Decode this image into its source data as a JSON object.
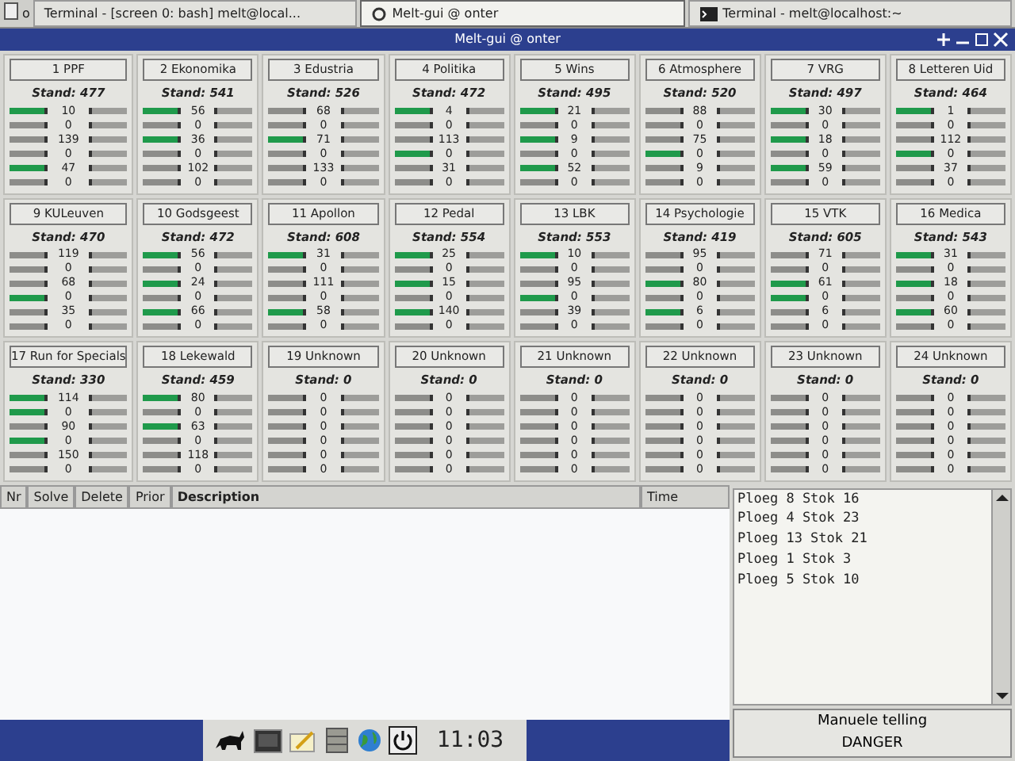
{
  "taskbar_top": {
    "label": "o",
    "tasks": [
      {
        "label": "Terminal - [screen 0: bash] melt@local...",
        "kind": "plain",
        "selected": false
      },
      {
        "label": "Melt-gui @ onter",
        "kind": "app",
        "selected": true
      },
      {
        "label": "Terminal - melt@localhost:~",
        "kind": "terminal",
        "selected": false
      }
    ]
  },
  "window": {
    "title": "Melt-gui @ onter"
  },
  "teams": [
    {
      "label": "1 PPF",
      "stand": "Stand: 477",
      "rows": [
        {
          "value": "10",
          "active": true
        },
        {
          "value": "0",
          "active": false
        },
        {
          "value": "139",
          "active": false
        },
        {
          "value": "0",
          "active": false
        },
        {
          "value": "47",
          "active": true
        },
        {
          "value": "0",
          "active": false
        }
      ]
    },
    {
      "label": "2 Ekonomika",
      "stand": "Stand: 541",
      "rows": [
        {
          "value": "56",
          "active": true
        },
        {
          "value": "0",
          "active": false
        },
        {
          "value": "36",
          "active": true
        },
        {
          "value": "0",
          "active": false
        },
        {
          "value": "102",
          "active": false
        },
        {
          "value": "0",
          "active": false
        }
      ]
    },
    {
      "label": "3 Edustria",
      "stand": "Stand: 526",
      "rows": [
        {
          "value": "68",
          "active": false
        },
        {
          "value": "0",
          "active": false
        },
        {
          "value": "71",
          "active": true
        },
        {
          "value": "0",
          "active": false
        },
        {
          "value": "133",
          "active": false
        },
        {
          "value": "0",
          "active": false
        }
      ]
    },
    {
      "label": "4 Politika",
      "stand": "Stand: 472",
      "rows": [
        {
          "value": "4",
          "active": true
        },
        {
          "value": "0",
          "active": false
        },
        {
          "value": "113",
          "active": false
        },
        {
          "value": "0",
          "active": true
        },
        {
          "value": "31",
          "active": false
        },
        {
          "value": "0",
          "active": false
        }
      ]
    },
    {
      "label": "5 Wins",
      "stand": "Stand: 495",
      "rows": [
        {
          "value": "21",
          "active": true
        },
        {
          "value": "0",
          "active": false
        },
        {
          "value": "9",
          "active": true
        },
        {
          "value": "0",
          "active": false
        },
        {
          "value": "52",
          "active": true
        },
        {
          "value": "0",
          "active": false
        }
      ]
    },
    {
      "label": "6 Atmosphere",
      "stand": "Stand: 520",
      "rows": [
        {
          "value": "88",
          "active": false
        },
        {
          "value": "0",
          "active": false
        },
        {
          "value": "75",
          "active": false
        },
        {
          "value": "0",
          "active": true
        },
        {
          "value": "9",
          "active": false
        },
        {
          "value": "0",
          "active": false
        }
      ]
    },
    {
      "label": "7 VRG",
      "stand": "Stand: 497",
      "rows": [
        {
          "value": "30",
          "active": true
        },
        {
          "value": "0",
          "active": false
        },
        {
          "value": "18",
          "active": true
        },
        {
          "value": "0",
          "active": false
        },
        {
          "value": "59",
          "active": true
        },
        {
          "value": "0",
          "active": false
        }
      ]
    },
    {
      "label": "8 Letteren Uid",
      "stand": "Stand: 464",
      "rows": [
        {
          "value": "1",
          "active": true
        },
        {
          "value": "0",
          "active": false
        },
        {
          "value": "112",
          "active": false
        },
        {
          "value": "0",
          "active": true
        },
        {
          "value": "37",
          "active": false
        },
        {
          "value": "0",
          "active": false
        }
      ]
    },
    {
      "label": "9 KULeuven",
      "stand": "Stand: 470",
      "rows": [
        {
          "value": "119",
          "active": false
        },
        {
          "value": "0",
          "active": false
        },
        {
          "value": "68",
          "active": false
        },
        {
          "value": "0",
          "active": true
        },
        {
          "value": "35",
          "active": false
        },
        {
          "value": "0",
          "active": false
        }
      ]
    },
    {
      "label": "10 Godsgeest",
      "stand": "Stand: 472",
      "rows": [
        {
          "value": "56",
          "active": true
        },
        {
          "value": "0",
          "active": false
        },
        {
          "value": "24",
          "active": true
        },
        {
          "value": "0",
          "active": false
        },
        {
          "value": "66",
          "active": true
        },
        {
          "value": "0",
          "active": false
        }
      ]
    },
    {
      "label": "11 Apollon",
      "stand": "Stand: 608",
      "rows": [
        {
          "value": "31",
          "active": true
        },
        {
          "value": "0",
          "active": false
        },
        {
          "value": "111",
          "active": false
        },
        {
          "value": "0",
          "active": false
        },
        {
          "value": "58",
          "active": true
        },
        {
          "value": "0",
          "active": false
        }
      ]
    },
    {
      "label": "12 Pedal",
      "stand": "Stand: 554",
      "rows": [
        {
          "value": "25",
          "active": true
        },
        {
          "value": "0",
          "active": false
        },
        {
          "value": "15",
          "active": true
        },
        {
          "value": "0",
          "active": false
        },
        {
          "value": "140",
          "active": true
        },
        {
          "value": "0",
          "active": false
        }
      ]
    },
    {
      "label": "13 LBK",
      "stand": "Stand: 553",
      "rows": [
        {
          "value": "10",
          "active": true
        },
        {
          "value": "0",
          "active": false
        },
        {
          "value": "95",
          "active": false
        },
        {
          "value": "0",
          "active": true
        },
        {
          "value": "39",
          "active": false
        },
        {
          "value": "0",
          "active": false
        }
      ]
    },
    {
      "label": "14 Psychologie",
      "stand": "Stand: 419",
      "rows": [
        {
          "value": "95",
          "active": false
        },
        {
          "value": "0",
          "active": false
        },
        {
          "value": "80",
          "active": true
        },
        {
          "value": "0",
          "active": false
        },
        {
          "value": "6",
          "active": true
        },
        {
          "value": "0",
          "active": false
        }
      ]
    },
    {
      "label": "15 VTK",
      "stand": "Stand: 605",
      "rows": [
        {
          "value": "71",
          "active": false
        },
        {
          "value": "0",
          "active": false
        },
        {
          "value": "61",
          "active": true
        },
        {
          "value": "0",
          "active": true
        },
        {
          "value": "6",
          "active": false
        },
        {
          "value": "0",
          "active": false
        }
      ]
    },
    {
      "label": "16 Medica",
      "stand": "Stand: 543",
      "rows": [
        {
          "value": "31",
          "active": true
        },
        {
          "value": "0",
          "active": false
        },
        {
          "value": "18",
          "active": true
        },
        {
          "value": "0",
          "active": false
        },
        {
          "value": "60",
          "active": true
        },
        {
          "value": "0",
          "active": false
        }
      ]
    },
    {
      "label": "17 Run for Specials",
      "stand": "Stand: 330",
      "rows": [
        {
          "value": "114",
          "active": true
        },
        {
          "value": "0",
          "active": true
        },
        {
          "value": "90",
          "active": false
        },
        {
          "value": "0",
          "active": true
        },
        {
          "value": "150",
          "active": false
        },
        {
          "value": "0",
          "active": false
        }
      ]
    },
    {
      "label": "18 Lekewald",
      "stand": "Stand: 459",
      "rows": [
        {
          "value": "80",
          "active": true
        },
        {
          "value": "0",
          "active": false
        },
        {
          "value": "63",
          "active": true
        },
        {
          "value": "0",
          "active": false
        },
        {
          "value": "118",
          "active": false
        },
        {
          "value": "0",
          "active": false
        }
      ]
    },
    {
      "label": "19 Unknown",
      "stand": "Stand: 0",
      "rows": [
        {
          "value": "0",
          "active": false
        },
        {
          "value": "0",
          "active": false
        },
        {
          "value": "0",
          "active": false
        },
        {
          "value": "0",
          "active": false
        },
        {
          "value": "0",
          "active": false
        },
        {
          "value": "0",
          "active": false
        }
      ]
    },
    {
      "label": "20 Unknown",
      "stand": "Stand: 0",
      "rows": [
        {
          "value": "0",
          "active": false
        },
        {
          "value": "0",
          "active": false
        },
        {
          "value": "0",
          "active": false
        },
        {
          "value": "0",
          "active": false
        },
        {
          "value": "0",
          "active": false
        },
        {
          "value": "0",
          "active": false
        }
      ]
    },
    {
      "label": "21 Unknown",
      "stand": "Stand: 0",
      "rows": [
        {
          "value": "0",
          "active": false
        },
        {
          "value": "0",
          "active": false
        },
        {
          "value": "0",
          "active": false
        },
        {
          "value": "0",
          "active": false
        },
        {
          "value": "0",
          "active": false
        },
        {
          "value": "0",
          "active": false
        }
      ]
    },
    {
      "label": "22 Unknown",
      "stand": "Stand: 0",
      "rows": [
        {
          "value": "0",
          "active": false
        },
        {
          "value": "0",
          "active": false
        },
        {
          "value": "0",
          "active": false
        },
        {
          "value": "0",
          "active": false
        },
        {
          "value": "0",
          "active": false
        },
        {
          "value": "0",
          "active": false
        }
      ]
    },
    {
      "label": "23 Unknown",
      "stand": "Stand: 0",
      "rows": [
        {
          "value": "0",
          "active": false
        },
        {
          "value": "0",
          "active": false
        },
        {
          "value": "0",
          "active": false
        },
        {
          "value": "0",
          "active": false
        },
        {
          "value": "0",
          "active": false
        },
        {
          "value": "0",
          "active": false
        }
      ]
    },
    {
      "label": "24 Unknown",
      "stand": "Stand: 0",
      "rows": [
        {
          "value": "0",
          "active": false
        },
        {
          "value": "0",
          "active": false
        },
        {
          "value": "0",
          "active": false
        },
        {
          "value": "0",
          "active": false
        },
        {
          "value": "0",
          "active": false
        },
        {
          "value": "0",
          "active": false
        }
      ]
    }
  ],
  "table": {
    "columns": [
      "Nr",
      "Solve",
      "Delete",
      "Prior",
      "Description",
      "Time"
    ]
  },
  "log": [
    "Ploeg 8  Stok 16",
    "Ploeg 4  Stok 23",
    "Ploeg 13 Stok 21",
    "Ploeg 1  Stok 3",
    "Ploeg 5  Stok 10"
  ],
  "action_button": {
    "lines": [
      "Manuele telling",
      "DANGER"
    ]
  },
  "taskbar_bottom": {
    "clock": "11:03"
  }
}
